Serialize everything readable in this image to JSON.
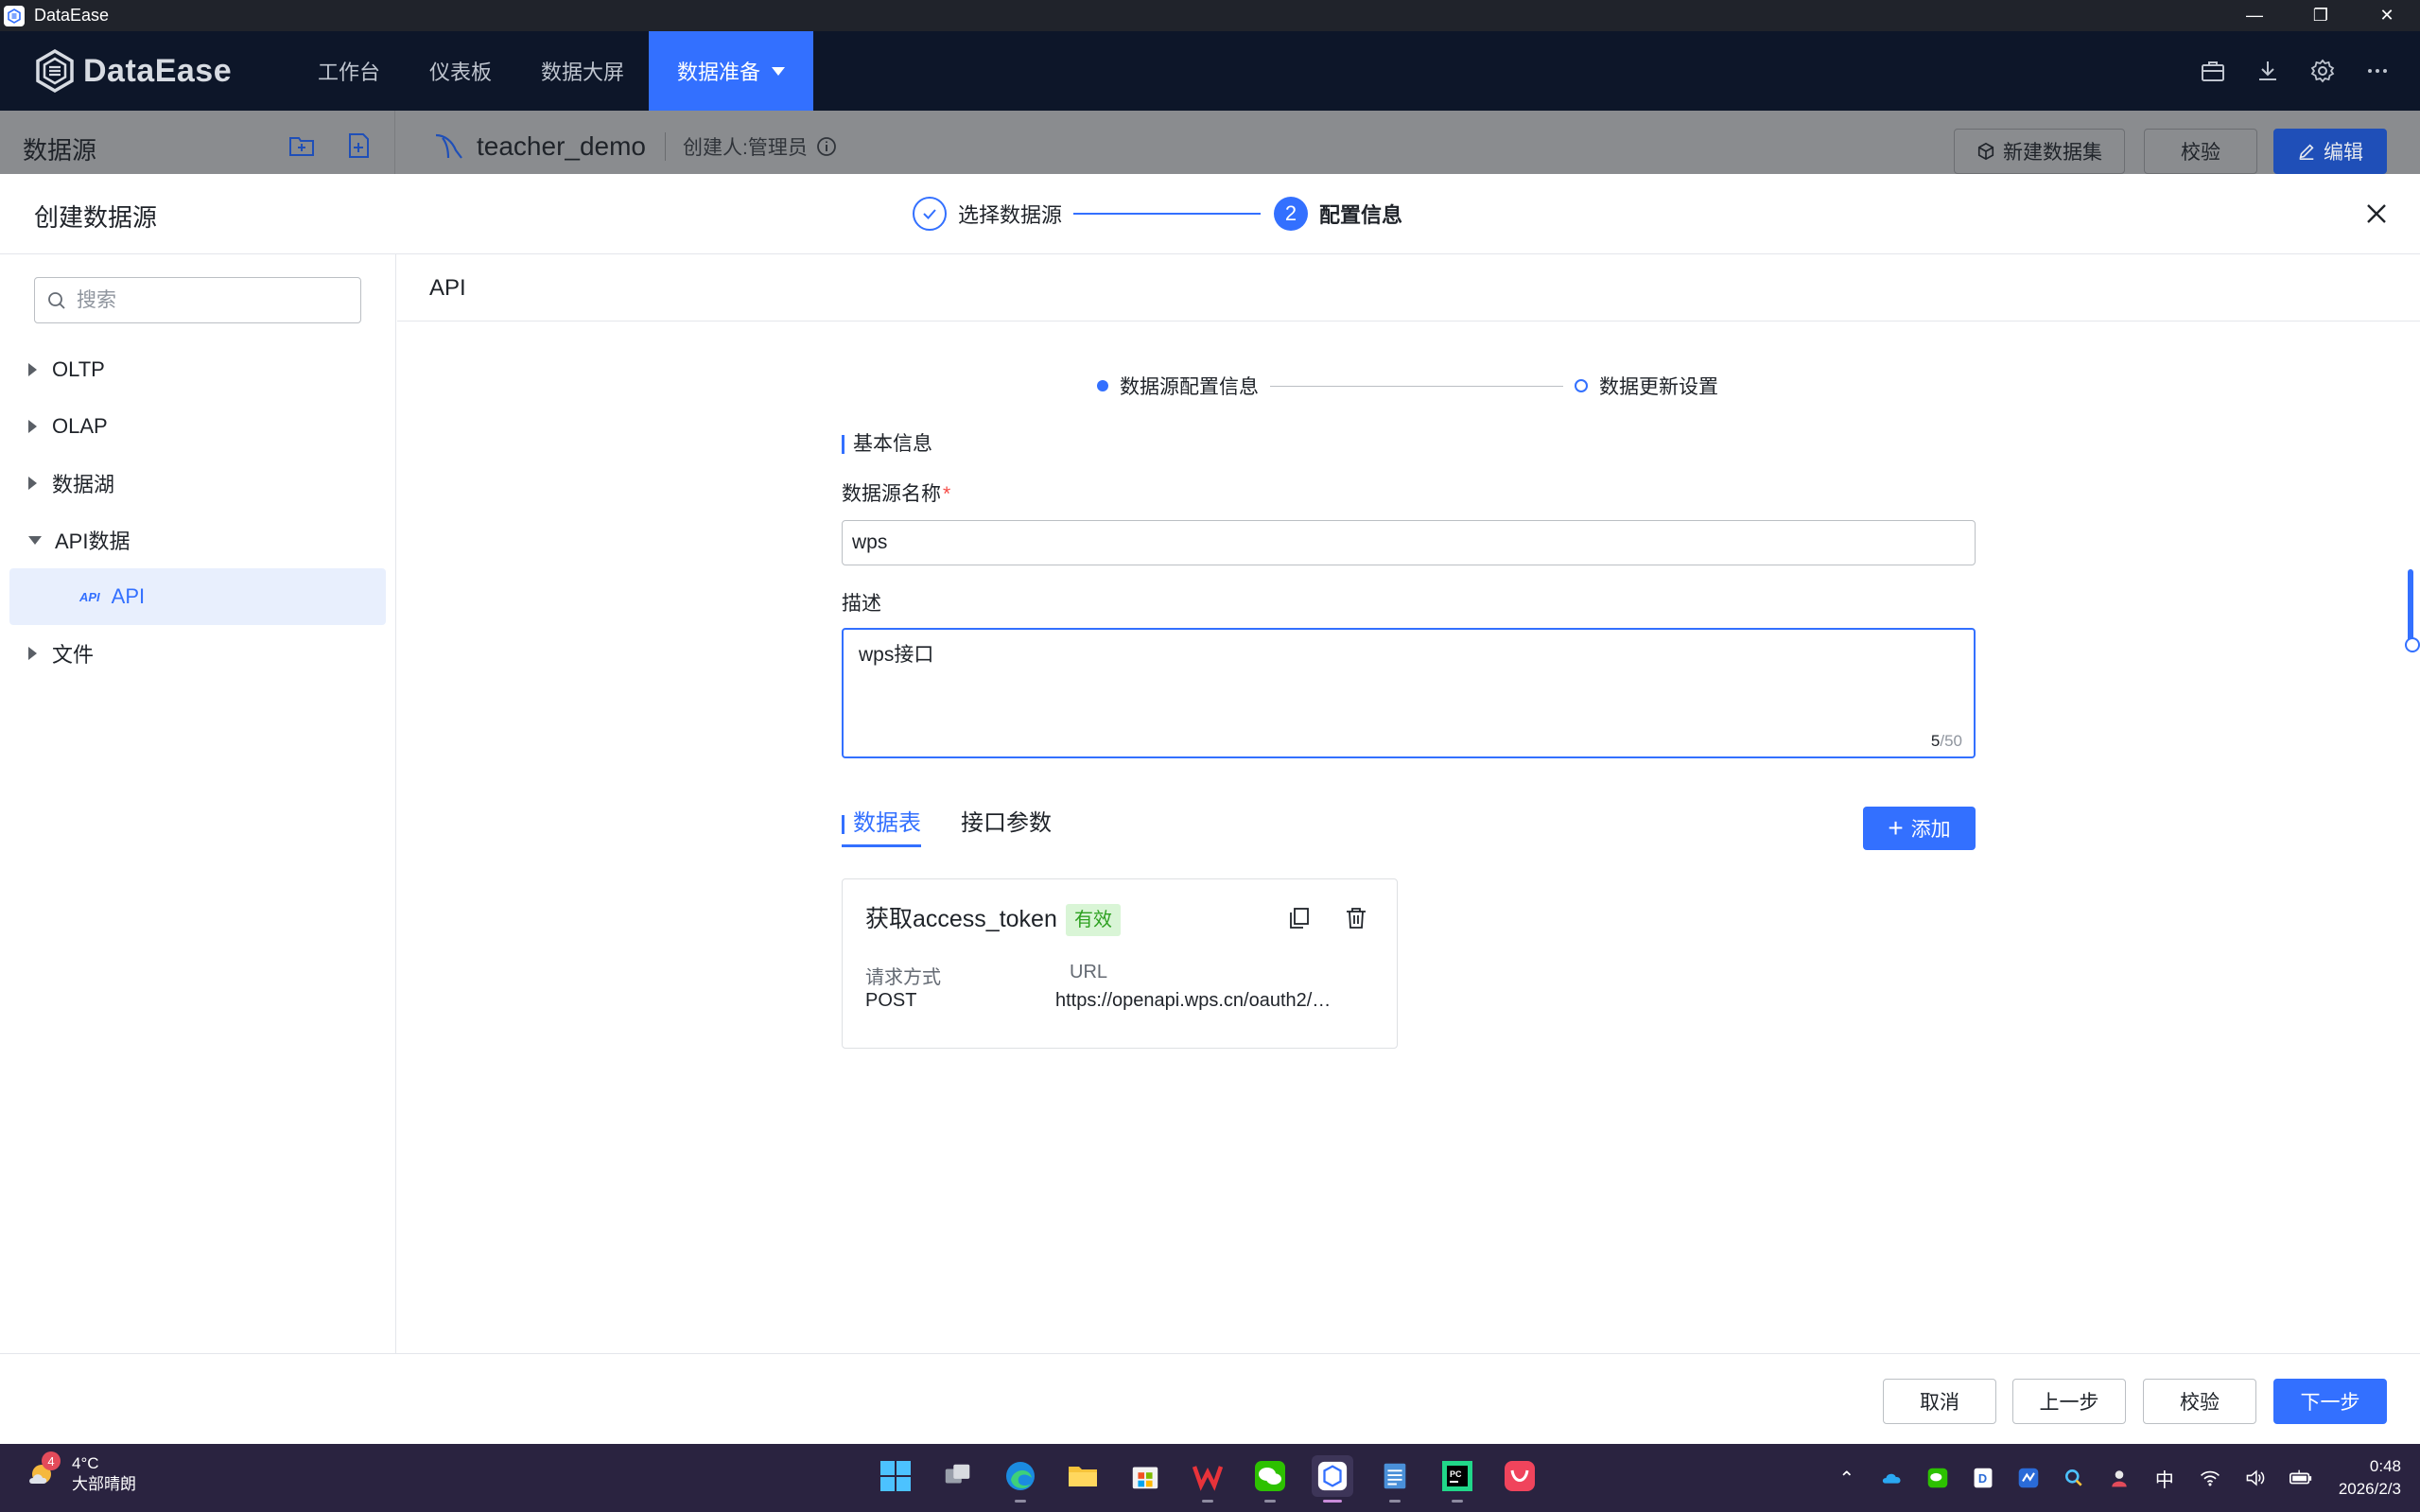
{
  "window": {
    "title": "DataEase"
  },
  "header": {
    "logo_text": "DataEase",
    "nav": [
      {
        "label": "工作台"
      },
      {
        "label": "仪表板"
      },
      {
        "label": "数据大屏"
      },
      {
        "label": "数据准备",
        "active": true
      }
    ],
    "icons": [
      "toolbox-icon",
      "download-icon",
      "settings-icon",
      "more-icon"
    ]
  },
  "background_page": {
    "sidebar_title": "数据源",
    "datasource_name": "teacher_demo",
    "creator": "创建人:管理员",
    "buttons": {
      "new_dataset": "新建数据集",
      "validate": "校验",
      "edit": "编辑"
    }
  },
  "modal": {
    "title": "创建数据源",
    "steps": [
      {
        "label": "选择数据源",
        "status": "done"
      },
      {
        "number": "2",
        "label": "配置信息",
        "status": "active"
      }
    ],
    "search_placeholder": "搜索",
    "tree": [
      {
        "label": "OLTP",
        "expanded": false
      },
      {
        "label": "OLAP",
        "expanded": false
      },
      {
        "label": "数据湖",
        "expanded": false
      },
      {
        "label": "API数据",
        "expanded": true,
        "children": [
          {
            "icon_text": "API",
            "label": "API",
            "selected": true
          }
        ]
      },
      {
        "label": "文件",
        "expanded": false
      }
    ],
    "main_title": "API",
    "substeps": [
      {
        "label": "数据源配置信息"
      },
      {
        "label": "数据更新设置"
      }
    ],
    "form": {
      "section_title": "基本信息",
      "name_label": "数据源名称",
      "required_mark": "*",
      "name_value": "wps",
      "desc_label": "描述",
      "desc_value": "wps接口",
      "desc_count": "5",
      "desc_max": "/50"
    },
    "tabs": [
      {
        "label": "数据表",
        "active": true
      },
      {
        "label": "接口参数"
      }
    ],
    "add_button": "添加",
    "card": {
      "title": "获取access_token",
      "badge": "有效",
      "method_label": "请求方式",
      "method_value": "POST",
      "url_label": "URL",
      "url_value": "https://openapi.wps.cn/oauth2/…"
    },
    "footer": {
      "cancel": "取消",
      "prev": "上一步",
      "validate": "校验",
      "next": "下一步"
    }
  },
  "taskbar": {
    "weather": {
      "badge": "4",
      "temp": "4°C",
      "desc": "大部晴朗"
    },
    "tray_ime": "中",
    "time": "0:48",
    "date": "2026/2/3"
  },
  "colors": {
    "primary": "#3370ff",
    "header_bg": "#0d1629",
    "success": "#2ea121",
    "taskbar_bg": "#2a2340"
  }
}
